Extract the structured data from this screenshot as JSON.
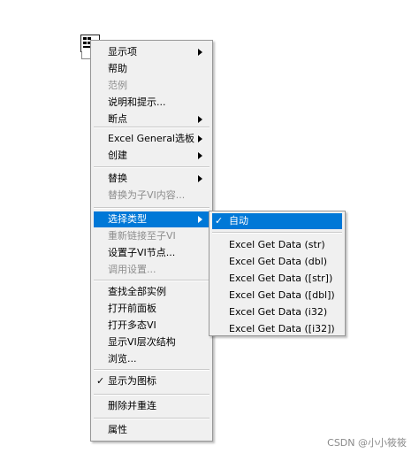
{
  "main_menu": {
    "groups": [
      [
        {
          "label": "显示项",
          "submenu": true,
          "disabled": false
        },
        {
          "label": "帮助",
          "submenu": false,
          "disabled": false
        },
        {
          "label": "范例",
          "submenu": false,
          "disabled": true
        },
        {
          "label": "说明和提示...",
          "submenu": false,
          "disabled": false
        },
        {
          "label": "断点",
          "submenu": true,
          "disabled": false
        }
      ],
      [
        {
          "label": "Excel General选板",
          "submenu": true,
          "disabled": false
        },
        {
          "label": "创建",
          "submenu": true,
          "disabled": false
        }
      ],
      [
        {
          "label": "替换",
          "submenu": true,
          "disabled": false
        },
        {
          "label": "替换为子VI内容...",
          "submenu": false,
          "disabled": true
        }
      ],
      [
        {
          "label": "选择类型",
          "submenu": true,
          "disabled": false,
          "highlighted": true
        },
        {
          "label": "重新链接至子VI",
          "submenu": false,
          "disabled": true
        },
        {
          "label": "设置子VI节点...",
          "submenu": false,
          "disabled": false
        },
        {
          "label": "调用设置...",
          "submenu": false,
          "disabled": true
        }
      ],
      [
        {
          "label": "查找全部实例",
          "submenu": false,
          "disabled": false
        },
        {
          "label": "打开前面板",
          "submenu": false,
          "disabled": false
        },
        {
          "label": "打开多态VI",
          "submenu": false,
          "disabled": false
        },
        {
          "label": "显示VI层次结构",
          "submenu": false,
          "disabled": false
        },
        {
          "label": "浏览...",
          "submenu": false,
          "disabled": false
        }
      ],
      [
        {
          "label": "显示为图标",
          "submenu": false,
          "disabled": false,
          "checked": true
        }
      ],
      [
        {
          "label": "删除并重连",
          "submenu": false,
          "disabled": false
        }
      ],
      [
        {
          "label": "属性",
          "submenu": false,
          "disabled": false
        }
      ]
    ]
  },
  "sub_menu": {
    "items": [
      {
        "label": "自动",
        "checked": true,
        "highlighted": true
      },
      {
        "label": "Excel Get Data (str)"
      },
      {
        "label": "Excel Get Data (dbl)"
      },
      {
        "label": "Excel Get Data ([str])"
      },
      {
        "label": "Excel Get Data ([dbl])"
      },
      {
        "label": "Excel Get Data (i32)"
      },
      {
        "label": "Excel Get Data ([i32])"
      }
    ]
  },
  "check_glyph": "✓",
  "watermark": "CSDN @小小筱筱",
  "colors": {
    "menu_bg": "#f0f0f0",
    "highlight": "#0078d7",
    "disabled_text": "#8d8d8d",
    "separator": "#c9c9c9"
  }
}
